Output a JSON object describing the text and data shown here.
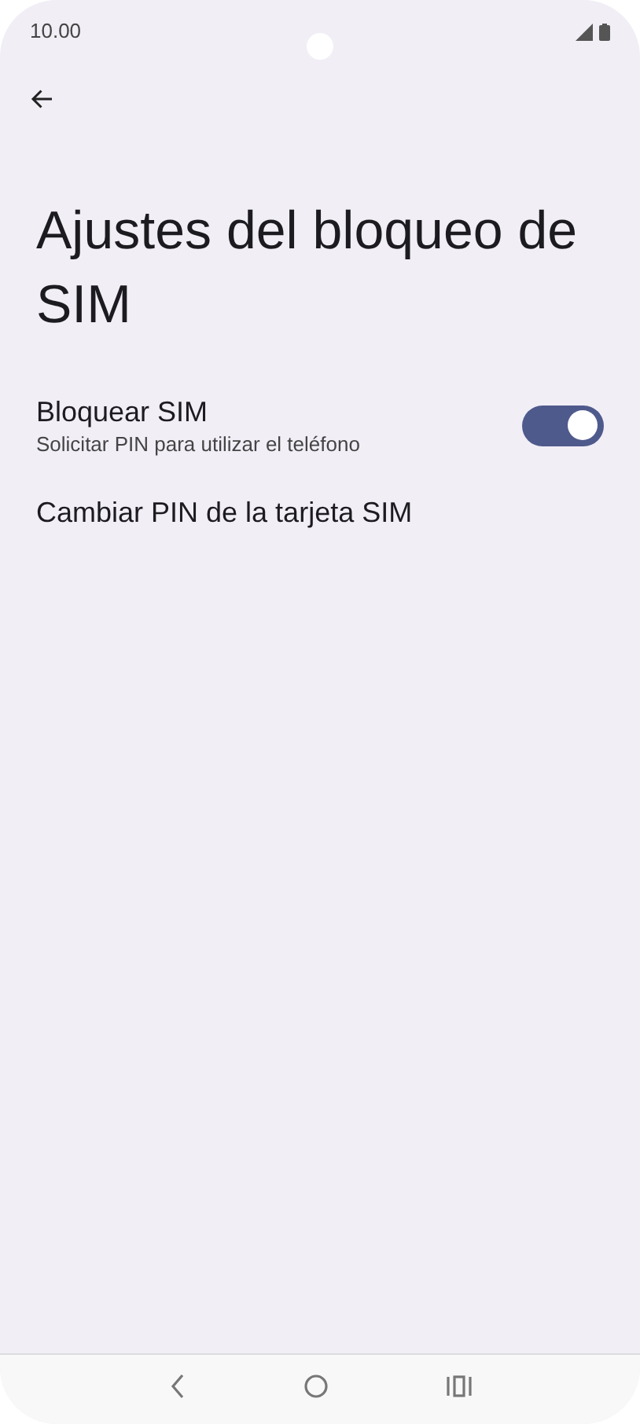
{
  "status_bar": {
    "time": "10.00"
  },
  "title": "Ajustes del bloqueo de SIM",
  "settings": [
    {
      "kind": "toggle",
      "label": "Bloquear SIM",
      "summary": "Solicitar PIN para utilizar el teléfono",
      "on": true
    },
    {
      "kind": "plain",
      "label": "Cambiar PIN de la tarjeta SIM"
    }
  ]
}
